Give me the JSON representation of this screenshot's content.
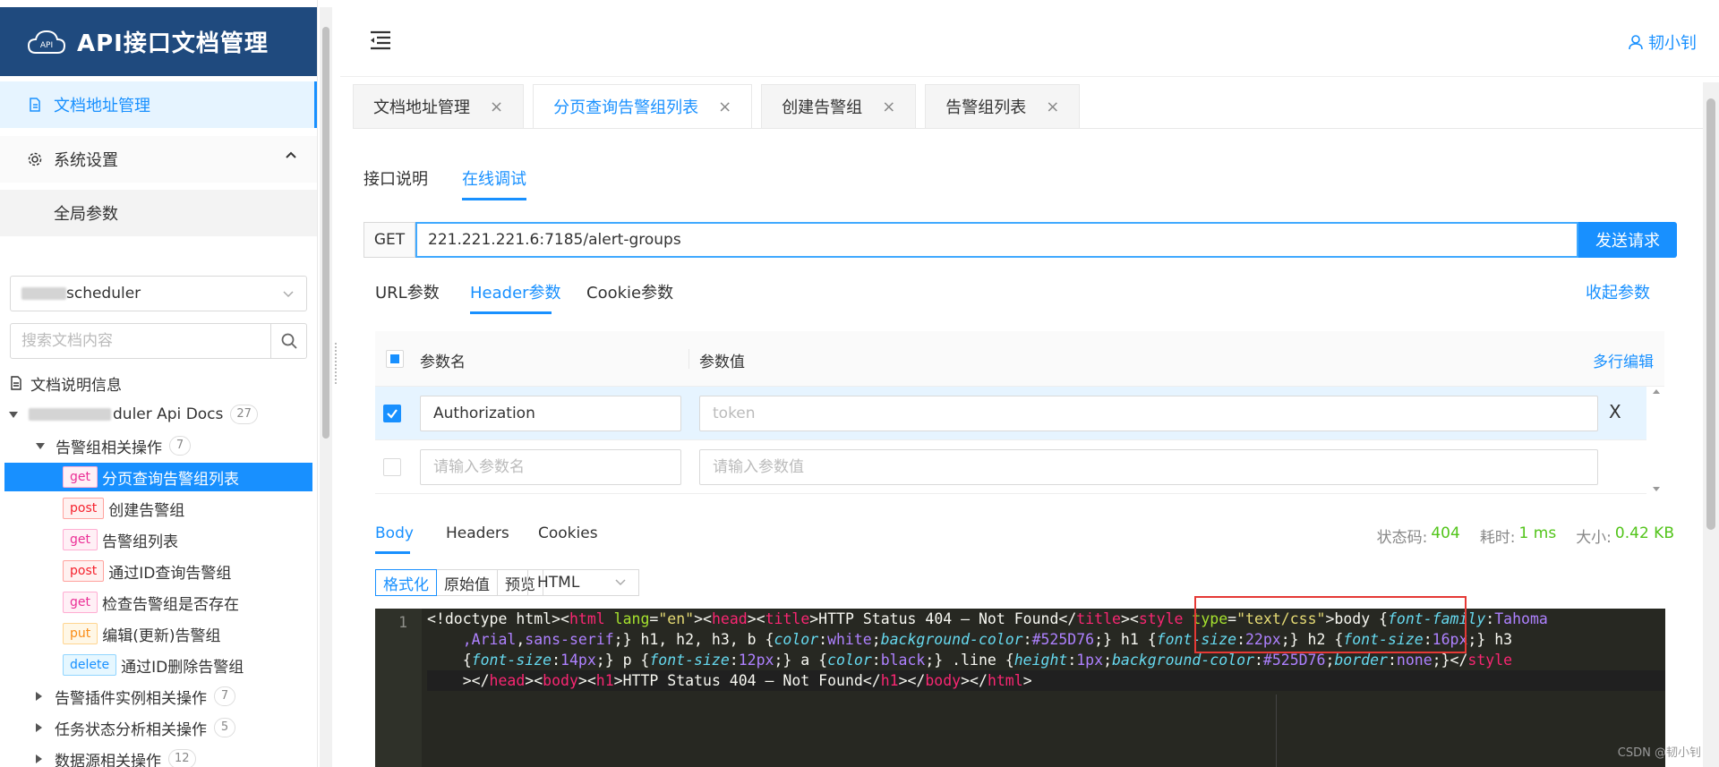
{
  "brand": {
    "title": "API接口文档管理",
    "logo_text": "API"
  },
  "menu": {
    "docs": "文档地址管理",
    "system": "系统设置",
    "global_params": "全局参数"
  },
  "group_select": {
    "value": "scheduler"
  },
  "search": {
    "placeholder": "搜索文档内容"
  },
  "tree": {
    "doc_info": "文档说明信息",
    "root": {
      "label": "duler Api Docs",
      "count": "27"
    },
    "group": {
      "label": "告警组相关操作",
      "count": "7"
    },
    "apis": [
      {
        "method": "get",
        "label": "分页查询告警组列表"
      },
      {
        "method": "post",
        "label": "创建告警组"
      },
      {
        "method": "get",
        "label": "告警组列表"
      },
      {
        "method": "post",
        "label": "通过ID查询告警组"
      },
      {
        "method": "get",
        "label": "检查告警组是否存在"
      },
      {
        "method": "put",
        "label": "编辑(更新)告警组"
      },
      {
        "method": "delete",
        "label": "通过ID删除告警组"
      }
    ],
    "others": [
      {
        "label": "告警插件实例相关操作",
        "count": "7"
      },
      {
        "label": "任务状态分析相关操作",
        "count": "5"
      },
      {
        "label": "数据源相关操作",
        "count": "12"
      }
    ]
  },
  "header": {
    "user": "韧小钊"
  },
  "tabs": [
    {
      "label": "文档地址管理"
    },
    {
      "label": "分页查询告警组列表"
    },
    {
      "label": "创建告警组"
    },
    {
      "label": "告警组列表"
    }
  ],
  "close_glyph": "×",
  "subtabs": {
    "desc": "接口说明",
    "debug": "在线调试"
  },
  "request": {
    "method": "GET",
    "url": "221.221.221.6:7185/alert-groups",
    "send": "发送请求"
  },
  "param_tabs": {
    "url": "URL参数",
    "header": "Header参数",
    "cookie": "Cookie参数",
    "collapse": "收起参数"
  },
  "param_table": {
    "col_name": "参数名",
    "col_value": "参数值",
    "multi_edit": "多行编辑",
    "rows": [
      {
        "name": "Authorization",
        "value_placeholder": "token"
      }
    ],
    "new_name_placeholder": "请输入参数名",
    "new_value_placeholder": "请输入参数值",
    "delete_glyph": "X"
  },
  "response": {
    "tabs": {
      "body": "Body",
      "headers": "Headers",
      "cookies": "Cookies"
    },
    "status_label": "状态码:",
    "status": "404",
    "time_label": "耗时:",
    "time": "1 ms",
    "size_label": "大小:",
    "size": "0.42 KB",
    "formats": {
      "pretty": "格式化",
      "raw": "原始值",
      "preview": "预览"
    },
    "lang": "HTML",
    "line_number": "1"
  },
  "watermark": "CSDN @韧小钊",
  "colors": {
    "brand": "#1f4a7e",
    "accent": "#1890ff",
    "success": "#52c41a",
    "highlight": "#e53935"
  }
}
